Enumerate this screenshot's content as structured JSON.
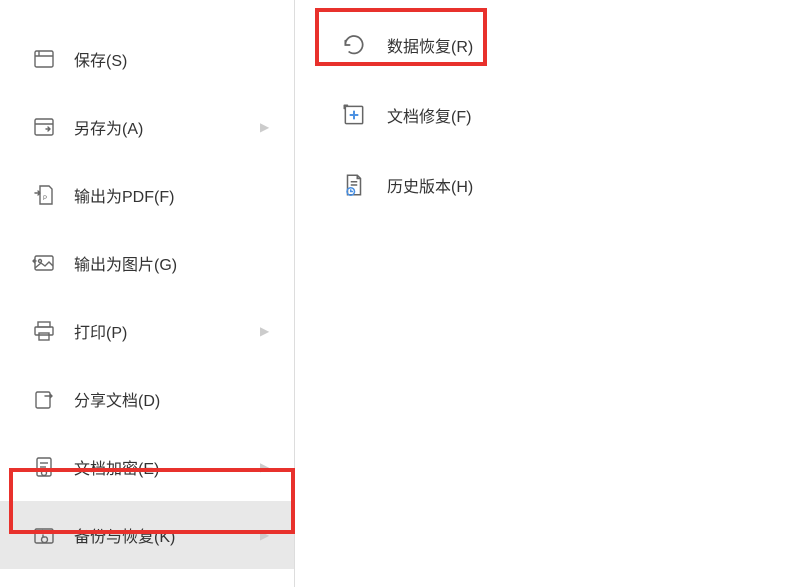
{
  "left_menu": {
    "save": {
      "label": "保存(S)",
      "has_arrow": false
    },
    "save_as": {
      "label": "另存为(A)",
      "has_arrow": true
    },
    "export_pdf": {
      "label": "输出为PDF(F)",
      "has_arrow": false
    },
    "export_image": {
      "label": "输出为图片(G)",
      "has_arrow": false
    },
    "print": {
      "label": "打印(P)",
      "has_arrow": true
    },
    "share": {
      "label": "分享文档(D)",
      "has_arrow": false
    },
    "encrypt": {
      "label": "文档加密(E)",
      "has_arrow": true
    },
    "backup_restore": {
      "label": "备份与恢复(K)",
      "has_arrow": true
    }
  },
  "right_menu": {
    "data_recovery": {
      "label": "数据恢复(R)"
    },
    "doc_repair": {
      "label": "文档修复(F)"
    },
    "history": {
      "label": "历史版本(H)"
    }
  },
  "highlights": {
    "color": "#e8312c"
  }
}
